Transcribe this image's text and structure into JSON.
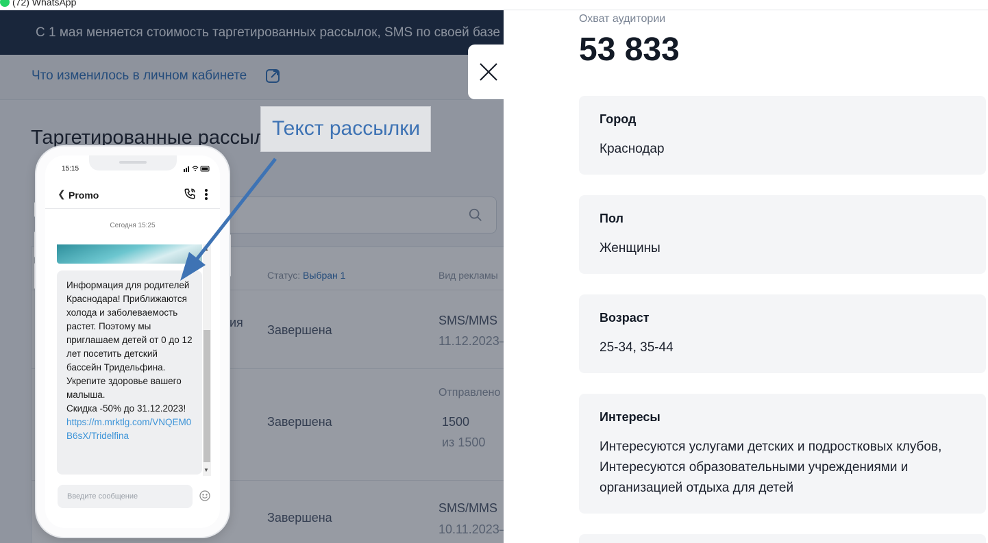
{
  "browser": {
    "tab_title": "(72) WhatsApp"
  },
  "left": {
    "banner": "С 1 мая меняется стоимость таргетированных рассылок, SMS по своей базе",
    "changes_link": "Что изменилось в личном кабинете",
    "heading": "Таргетированные рассылки",
    "table": {
      "status_header": "Статус:",
      "status_selected": "Выбран 1",
      "type_header": "Вид рекламы",
      "name_fragment": "ия",
      "rows": [
        {
          "status": "Завершена",
          "type": "SMS/MMS",
          "date": "11.12.2023–"
        },
        {
          "status": "Завершена",
          "sent_label": "Отправлено",
          "sent": "1500",
          "sent_of": "из 1500"
        },
        {
          "status": "Завершена",
          "type": "SMS/MMS",
          "date": "10.11.2023–"
        }
      ]
    }
  },
  "callout": {
    "text": "Текст рассылки"
  },
  "phone": {
    "time": "15:15",
    "chat_name": "Promo",
    "date_separator": "Сегодня 15:25",
    "message": "Информация для родителей Краснодара! Приближаются холода и заболеваемость растет. Поэтому мы приглашаем детей от 0 до 12 лет посетить детский бассейн Тридельфина. Укрепите здоровье вашего малыша.\nСкидка -50% до 31.12.2023!",
    "message_link": "https://m.mrktlg.com/VNQEM0B6sX/Tridelfina",
    "input_placeholder": "Введите сообщение"
  },
  "drawer": {
    "reach_label": "Охват аудитории",
    "reach_value": "53 833",
    "cards": [
      {
        "label": "Город",
        "value": "Краснодар"
      },
      {
        "label": "Пол",
        "value": "Женщины"
      },
      {
        "label": "Возраст",
        "value": "25-34, 35-44"
      },
      {
        "label": "Интересы",
        "value": "Интересуются услугами детских и подростковых клубов, Интересуются образовательными учреждениями и организацией отдыха для детей"
      }
    ]
  },
  "colors": {
    "banner_bg": "#1b2b42",
    "link": "#2f6fb7",
    "card_bg": "#f4f5f7",
    "callout_text": "#3e73b4",
    "arrow": "#3e73b4"
  }
}
